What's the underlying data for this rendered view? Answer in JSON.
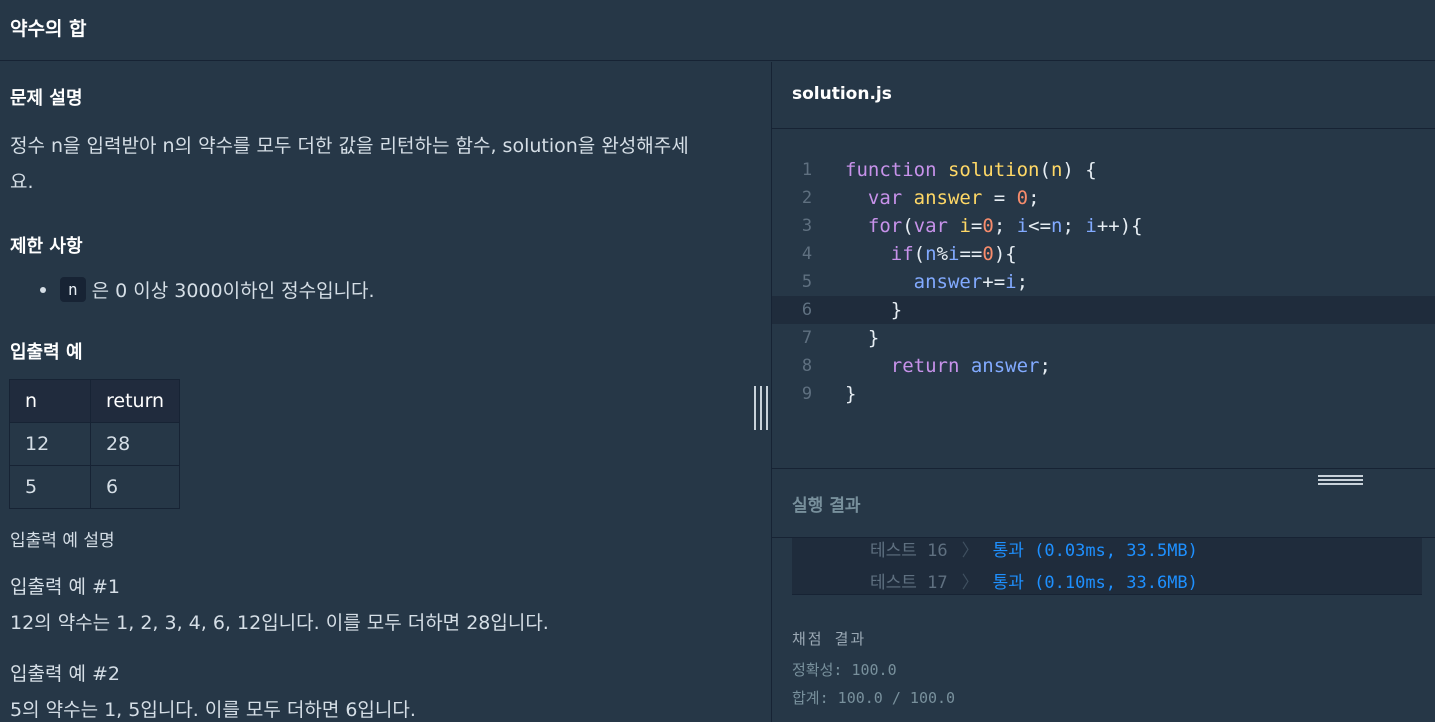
{
  "header": {
    "title": "약수의 합"
  },
  "problem": {
    "section_title": "문제 설명",
    "description_line1": "정수 n을 입력받아 n의 약수를 모두 더한 값을 리턴하는 함수, solution을 완성해주세",
    "description_line2": "요.",
    "constraints_title": "제한 사항",
    "constraint_code": "n",
    "constraint_text": "은 0 이상 3000이하인 정수입니다.",
    "examples_title": "입출력 예",
    "table": {
      "headers": [
        "n",
        "return"
      ],
      "rows": [
        [
          "12",
          "28"
        ],
        [
          "5",
          "6"
        ]
      ]
    },
    "examples_explain_title": "입출력 예 설명",
    "example1_title": "입출력 예 #1",
    "example1_text": "12의 약수는 1, 2, 3, 4, 6, 12입니다. 이를 모두 더하면 28입니다.",
    "example2_title": "입출력 예 #2",
    "example2_text": "5의 약수는 1, 5입니다. 이를 모두 더하면 6입니다."
  },
  "editor": {
    "filename": "solution.js",
    "line_numbers": [
      "1",
      "2",
      "3",
      "4",
      "5",
      "6",
      "7",
      "8",
      "9"
    ],
    "active_line": 6
  },
  "results": {
    "title": "실행 결과",
    "tests": [
      {
        "name": "테스트 16",
        "result": "통과 (0.03ms, 33.5MB)"
      },
      {
        "name": "테스트 17",
        "result": "통과 (0.10ms, 33.6MB)"
      }
    ],
    "grading_title": "채점 결과",
    "accuracy": "정확성: 100.0",
    "total": "합계: 100.0 / 100.0"
  },
  "colors": {
    "background": "#263747",
    "dark": "#172334",
    "pass": "#1e90ff",
    "keyword": "#c792ea",
    "function": "#ffd866",
    "number": "#f78c6c",
    "variable": "#82aaff"
  }
}
